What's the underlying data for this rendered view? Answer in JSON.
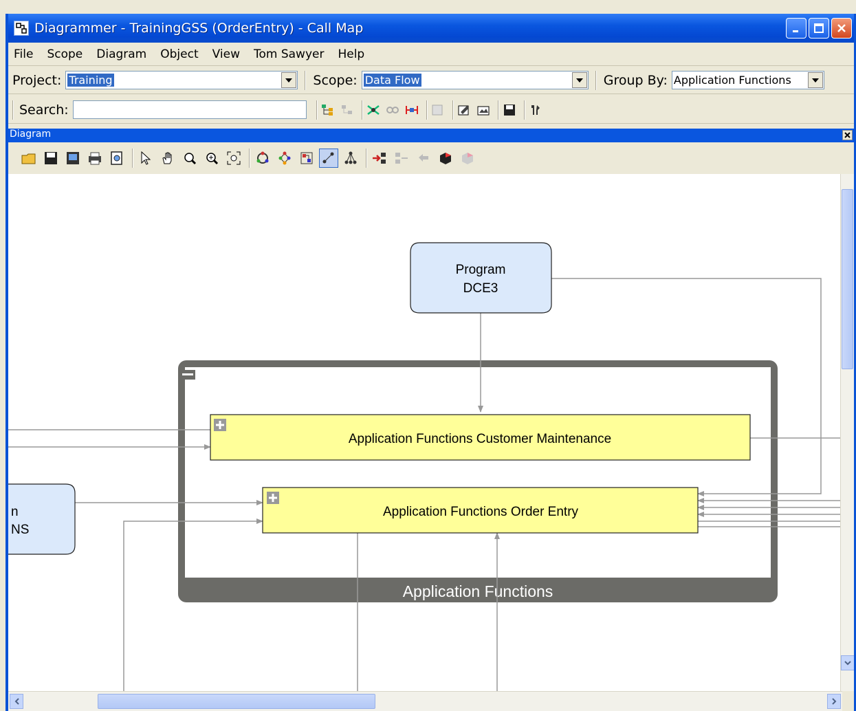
{
  "window": {
    "title": "Diagrammer - TrainingGSS (OrderEntry)  - Call Map",
    "icon": "app-diagram-icon"
  },
  "menu": [
    "File",
    "Scope",
    "Diagram",
    "Object",
    "View",
    "Tom Sawyer",
    "Help"
  ],
  "toolbar": {
    "project_label": "Project:",
    "project_value": "Training",
    "scope_label": "Scope:",
    "scope_value": "Data Flow",
    "groupby_label": "Group By:",
    "groupby_value": "Application Functions",
    "search_label": "Search:",
    "search_value": ""
  },
  "panel": {
    "title": "Diagram"
  },
  "diagram": {
    "program_node": {
      "line1": "Program",
      "line2": "DCE3"
    },
    "group_label": "Application Functions",
    "node_customer": "Application Functions Customer Maintenance",
    "node_order": "Application Functions Order Entry",
    "left_node": {
      "line1": "n",
      "line2": "NS"
    }
  },
  "colors": {
    "program_fill": "#dbe9fb",
    "function_fill": "#ffff99",
    "group_border": "#666666",
    "selection": "#316ac5"
  }
}
